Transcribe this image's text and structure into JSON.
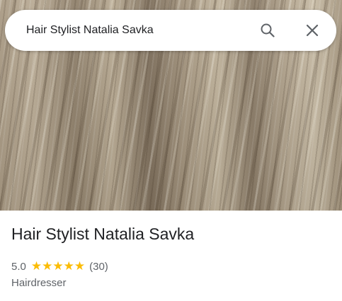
{
  "search": {
    "query": "Hair Stylist Natalia Savka"
  },
  "icons": {
    "search": "search-icon",
    "close": "close-icon",
    "star": "star-icon"
  },
  "place": {
    "name": "Hair Stylist Natalia Savka",
    "rating": "5.0",
    "stars": 5,
    "review_count": "(30)",
    "category": "Hairdresser"
  },
  "colors": {
    "star": "#fbbc04",
    "primary_text": "#202124",
    "secondary_text": "#5f6368",
    "icon": "#5f6368"
  }
}
